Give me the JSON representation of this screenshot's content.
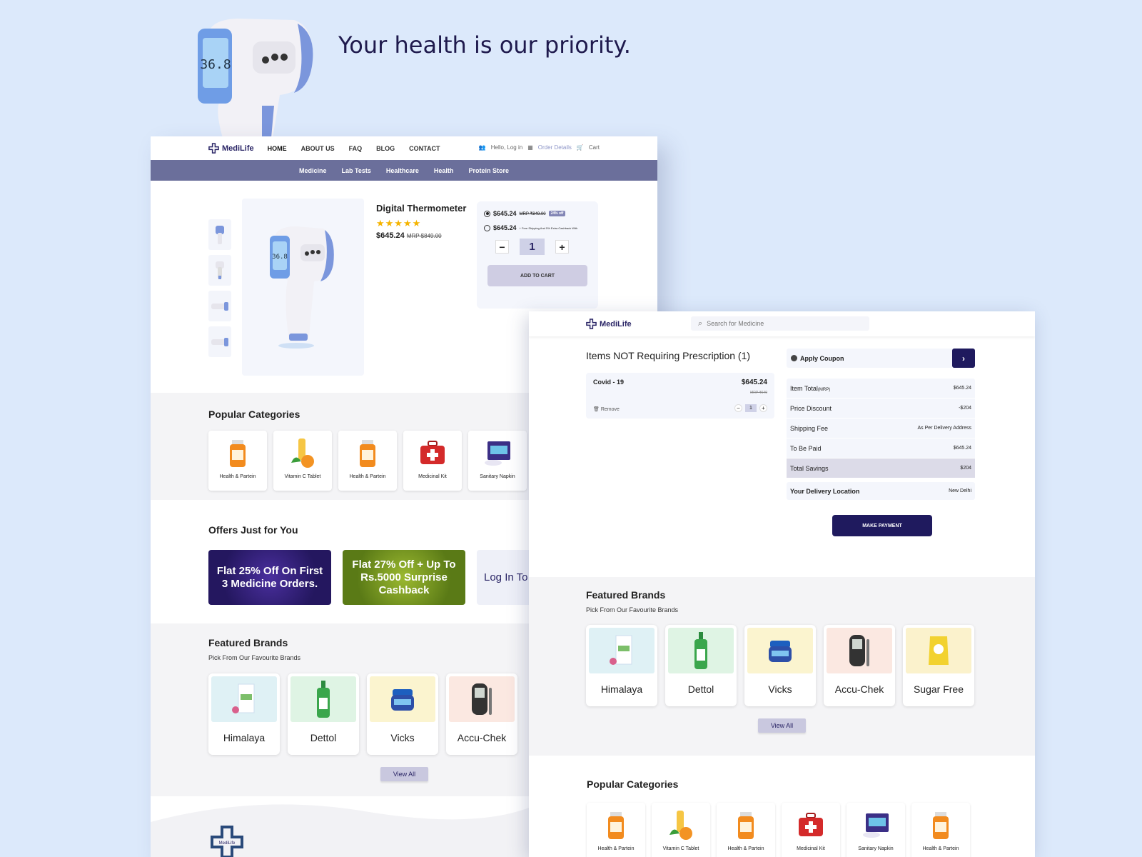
{
  "tagline": "Your health is our priority.",
  "hero_thermometer_reading": "36.8",
  "page1": {
    "brand": "MediLife",
    "nav": [
      "HOME",
      "ABOUT US",
      "FAQ",
      "BLOG",
      "CONTACT"
    ],
    "nav_right": {
      "login": "Hello, Log in",
      "orders": "Order Details",
      "cart": "Cart"
    },
    "categories_bar": [
      "Medicine",
      "Lab Tests",
      "Healthcare",
      "Health",
      "Protein Store"
    ],
    "product": {
      "title": "Digital Thermometer",
      "stars": "★★★★★",
      "rating": 5,
      "price": "$645.24",
      "mrp": "MRP $849.00"
    },
    "buybox": {
      "option1_price": "$645.24",
      "option1_mrp": "MRP ₹849.00",
      "option1_badge": "24% off",
      "option2_price": "$645.24",
      "option2_note": "+ Free Shipping And 5% Extra Cashback With",
      "qty": "1",
      "minus": "−",
      "plus": "+",
      "add_to_cart": "ADD TO CART"
    },
    "popular_title": "Popular Categories",
    "popular": [
      "Health & Partein",
      "Vitamin C Tablet",
      "Health & Partein",
      "Medicinal Kit",
      "Sanitary Napkin"
    ],
    "offers_title": "Offers Just for You",
    "offers": [
      "Flat 25% Off On First 3 Medicine Orders.",
      "Flat 27% Off + Up To Rs.5000 Surprise Cashback",
      "Log In To C"
    ],
    "brands_title": "Featured Brands",
    "brands_sub": "Pick From Our Favourite Brands",
    "brands": [
      "Himalaya",
      "Dettol",
      "Vicks",
      "Accu-Chek"
    ],
    "view_all": "View All",
    "footer_logo_text": "MediLife"
  },
  "page2": {
    "brand": "MediLife",
    "search_placeholder": "Search for Medicine",
    "rx_title": "Items NOT Requiring Prescription (1)",
    "item": {
      "name": "Covid - 19",
      "price": "$645.24",
      "mrp": "MRP ₹649",
      "remove": "Remove",
      "qty": "1",
      "minus": "−",
      "plus": "+"
    },
    "coupon": "Apply Coupon",
    "coupon_arrow": "›",
    "summary": [
      {
        "label": "Item Total",
        "label_suffix": "(MRP)",
        "value": "$645.24"
      },
      {
        "label": "Price Discount",
        "label_suffix": "",
        "value": "-$204"
      },
      {
        "label": "Shipping Fee",
        "label_suffix": "",
        "value": "As Per Delivery Address"
      },
      {
        "label": "To Be Paid",
        "label_suffix": "",
        "value": "$645.24"
      },
      {
        "label": "Total Savings",
        "label_suffix": "",
        "value": "$204"
      }
    ],
    "delivery": {
      "label": "Your Delivery Location",
      "value": "New Delhi"
    },
    "pay": "MAKE PAYMENT",
    "brands_title": "Featured Brands",
    "brands_sub": "Pick From Our Favourite Brands",
    "brands": [
      "Himalaya",
      "Dettol",
      "Vicks",
      "Accu-Chek",
      "Sugar Free"
    ],
    "view_all": "View All",
    "popular_title": "Popular Categories",
    "popular": [
      "Health & Partein",
      "Vitamin C Tablet",
      "Health & Partein",
      "Medicinal Kit",
      "Sanitary Napkin",
      "Health & Partein"
    ]
  },
  "colors": {
    "bg": "#dce9fb",
    "brand": "#1f1a5e",
    "catbar": "#6b6f9b",
    "star": "#f5b400",
    "offer1": "#2b1c6e",
    "offer2": "#6d8a1d"
  }
}
